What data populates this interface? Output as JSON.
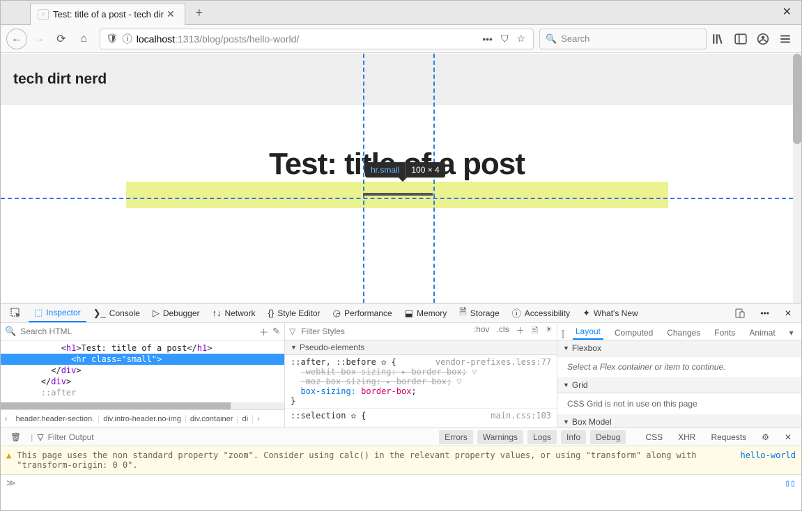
{
  "browser": {
    "tab_title": "Test: title of a post - tech dir",
    "new_tab_glyph": "+",
    "url_host": "localhost",
    "url_port": ":1313",
    "url_path": "/blog/posts/hello-world/",
    "search_placeholder": "Search"
  },
  "page": {
    "site_title": "tech dirt nerd",
    "post_title": "Test: title of a post",
    "tooltip_selector": "hr.small",
    "tooltip_dim": "100 × 4"
  },
  "devtools": {
    "tabs": {
      "inspector": "Inspector",
      "console": "Console",
      "debugger": "Debugger",
      "network": "Network",
      "style": "Style Editor",
      "perf": "Performance",
      "memory": "Memory",
      "storage": "Storage",
      "a11y": "Accessibility",
      "whatsnew": "What's New"
    },
    "search_html_ph": "Search HTML",
    "html": {
      "line1_open": "<h1>",
      "line1_text": "Test: title of a post",
      "line1_close": "</h1>",
      "line2": "<hr class=\"small\">",
      "line3": "</div>",
      "line4": "</div>",
      "line5": "::after"
    },
    "crumbs": {
      "c1": "header.header-section.",
      "c2": "div.intro-header.no-img",
      "c3": "div.container",
      "c4": "di"
    },
    "rules": {
      "filter_ph": "Filter Styles",
      "hov": ":hov",
      "cls": ".cls",
      "section_pseudo": "Pseudo-elements",
      "rule1_sel": "::after, ::before",
      "rule1_loc": "vendor-prefixes.less:77",
      "rule1_p1": "-webkit-box-sizing:",
      "rule1_v1": "border-box",
      "rule1_p2": "-moz-box-sizing:",
      "rule1_v2": "border-box",
      "rule1_p3": "box-sizing:",
      "rule1_v3": "border-box",
      "rule2_sel": "::selection",
      "rule2_loc": "main.css:103"
    },
    "layout": {
      "tabs": {
        "layout": "Layout",
        "computed": "Computed",
        "changes": "Changes",
        "fonts": "Fonts",
        "animat": "Animat"
      },
      "flexbox_hdr": "Flexbox",
      "flexbox_msg": "Select a Flex container or item to continue.",
      "grid_hdr": "Grid",
      "grid_msg": "CSS Grid is not in use on this page",
      "box_hdr": "Box Model"
    },
    "console": {
      "filter_ph": "Filter Output",
      "btns": {
        "errors": "Errors",
        "warnings": "Warnings",
        "logs": "Logs",
        "info": "Info",
        "debug": "Debug",
        "css": "CSS",
        "xhr": "XHR",
        "requests": "Requests"
      },
      "warn_msg": "This page uses the non standard property \"zoom\". Consider using calc() in the relevant property values, or using \"transform\" along with \"transform-origin: 0 0\".",
      "warn_src": "hello-world",
      "prompt": "≫"
    }
  }
}
